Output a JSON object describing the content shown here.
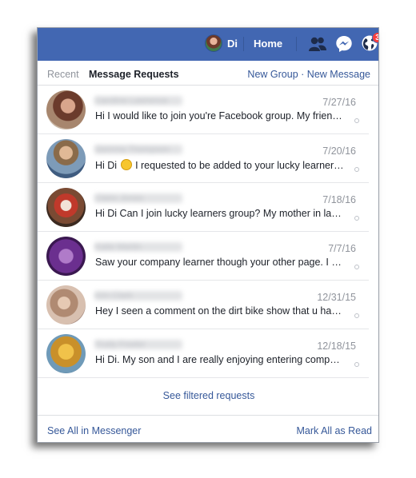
{
  "topbar": {
    "user_name": "Di",
    "home_label": "Home",
    "notification_count": "3",
    "brand_color": "#4267b2"
  },
  "tabs": {
    "recent": "Recent",
    "message_requests": "Message Requests"
  },
  "header_links": {
    "new_group": "New Group",
    "separator": "·",
    "new_message": "New Message"
  },
  "requests": [
    {
      "name": "Caroline Lawrence",
      "date": "7/27/16",
      "snippet": "Hi I would like to join you're Facebook group. My friend I am..."
    },
    {
      "name": "Gemma Thompson",
      "date": "7/20/16",
      "snippet_before": "Hi Di",
      "snippet_after": "I requested to be added to your lucky learners group"
    },
    {
      "name": "Claire Jones",
      "date": "7/18/16",
      "snippet": "Hi Di Can I join lucky learners group? My mother in law is a teacher"
    },
    {
      "name": "Katie Martin",
      "date": "7/7/16",
      "snippet": "Saw your company learner though your other page. I would like"
    },
    {
      "name": "Kim Clark",
      "date": "12/31/15",
      "snippet": "Hey I seen a comment on the dirt bike show that u had a lucky"
    },
    {
      "name": "Trudy Fowler",
      "date": "12/18/15",
      "snippet": "Hi Di. My son and I are really enjoying entering competitions"
    }
  ],
  "see_filtered": "See filtered requests",
  "footer": {
    "see_all": "See All in Messenger",
    "mark_all": "Mark All as Read"
  }
}
